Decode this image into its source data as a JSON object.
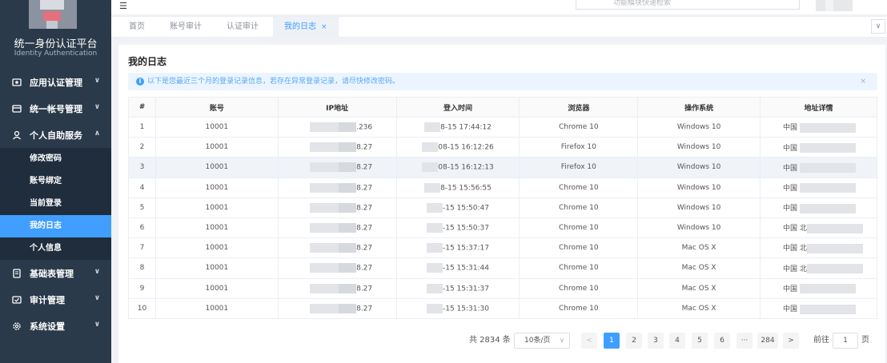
{
  "sidebar": {
    "brand_title": "统一身份认证平台",
    "brand_subtitle": "Identity Authentication",
    "menu": [
      {
        "label": "应用认证管理",
        "icon": "shield-app-icon",
        "expanded": false
      },
      {
        "label": "统一帐号管理",
        "icon": "account-card-icon",
        "expanded": false
      },
      {
        "label": "个人自助服务",
        "icon": "user-icon",
        "expanded": true
      },
      {
        "label": "基础表管理",
        "icon": "document-icon",
        "expanded": false
      },
      {
        "label": "审计管理",
        "icon": "audit-icon",
        "expanded": false
      },
      {
        "label": "系统设置",
        "icon": "gear-icon",
        "expanded": false
      }
    ],
    "submenu": [
      {
        "label": "修改密码",
        "active": false
      },
      {
        "label": "账号绑定",
        "active": false
      },
      {
        "label": "当前登录",
        "active": false
      },
      {
        "label": "我的日志",
        "active": true
      },
      {
        "label": "个人信息",
        "active": false
      }
    ]
  },
  "header": {
    "search_placeholder": "功能模块快速检索"
  },
  "tabs": [
    {
      "label": "首页",
      "active": false
    },
    {
      "label": "账号审计",
      "active": false
    },
    {
      "label": "认证审计",
      "active": false
    },
    {
      "label": "我的日志",
      "active": true,
      "close": "×"
    }
  ],
  "page": {
    "title": "我的日志",
    "alert_text": "以下是您最近三个月的登录记录信息，若存在异常登录记录，请尽快修改密码。",
    "alert_icon": "i",
    "alert_close": "×"
  },
  "table": {
    "columns": [
      "#",
      "账号",
      "IP地址",
      "登入时间",
      "浏览器",
      "操作系统",
      "地址详情"
    ],
    "rows": [
      {
        "index": "1",
        "account": "10001",
        "ip": ".236",
        "time": "8-15 17:44:12",
        "browser": "Chrome 10",
        "os": "Windows 10",
        "location": "中国 "
      },
      {
        "index": "2",
        "account": "10001",
        "ip": "8.27",
        "time": "08-15 16:12:26",
        "browser": "Firefox 10",
        "os": "Windows 10",
        "location": "中国 "
      },
      {
        "index": "3",
        "account": "10001",
        "ip": "8.27",
        "time": "08-15 16:12:13",
        "browser": "Firefox 10",
        "os": "Windows 10",
        "location": "中国 "
      },
      {
        "index": "4",
        "account": "10001",
        "ip": "8.27",
        "time": "8-15 15:56:55",
        "browser": "Chrome 10",
        "os": "Windows 10",
        "location": "中国 "
      },
      {
        "index": "5",
        "account": "10001",
        "ip": "8.27",
        "time": "-15 15:50:47",
        "browser": "Chrome 10",
        "os": "Windows 10",
        "location": "中国 "
      },
      {
        "index": "6",
        "account": "10001",
        "ip": "8.27",
        "time": "-15 15:50:37",
        "browser": "Chrome 10",
        "os": "Windows 10",
        "location": "中国 北"
      },
      {
        "index": "7",
        "account": "10001",
        "ip": "8.27",
        "time": "-15 15:37:17",
        "browser": "Chrome 10",
        "os": "Mac OS X",
        "location": "中国 北"
      },
      {
        "index": "8",
        "account": "10001",
        "ip": "8.27",
        "time": "-15 15:31:44",
        "browser": "Chrome 10",
        "os": "Mac OS X",
        "location": "中国 北"
      },
      {
        "index": "9",
        "account": "10001",
        "ip": "8.27",
        "time": "-15 15:31:37",
        "browser": "Chrome 10",
        "os": "Mac OS X",
        "location": "中国 "
      },
      {
        "index": "10",
        "account": "10001",
        "ip": "8.27",
        "time": "-15 15:31:30",
        "browser": "Chrome 10",
        "os": "Mac OS X",
        "location": "中国 "
      }
    ]
  },
  "pagination": {
    "total_text": "共 2834 条",
    "page_size": "10条/页",
    "prev": "<",
    "pages": [
      "1",
      "2",
      "3",
      "4",
      "5",
      "6"
    ],
    "ellipsis": "···",
    "last_page": "284",
    "next": ">",
    "goto_prefix": "前往",
    "goto_value": "1",
    "goto_suffix": "页",
    "current": 1
  },
  "colors": {
    "sidebar_bg": "#2b3a4a",
    "accent": "#409eff",
    "alert_bg": "#ecf5ff"
  }
}
